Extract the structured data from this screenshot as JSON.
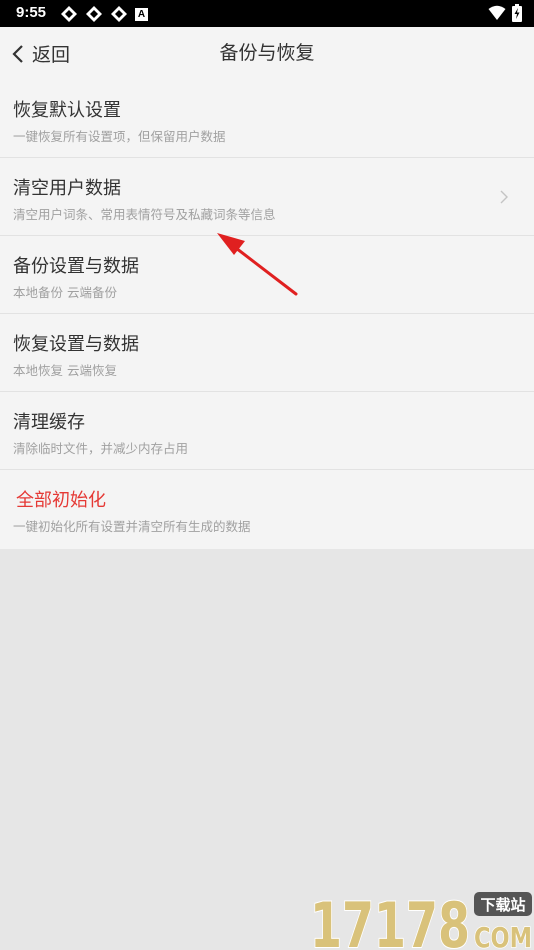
{
  "status_bar": {
    "time": "9:55",
    "indicator_badge": "A"
  },
  "nav": {
    "back_label": "返回",
    "title": "备份与恢复"
  },
  "items": [
    {
      "title": "恢复默认设置",
      "subtitle": "一键恢复所有设置项，但保留用户数据"
    },
    {
      "title": "清空用户数据",
      "subtitle": "清空用户词条、常用表情符号及私藏词条等信息"
    },
    {
      "title": "备份设置与数据",
      "subtitle": "本地备份 云端备份"
    },
    {
      "title": "恢复设置与数据",
      "subtitle": "本地恢复 云端恢复"
    },
    {
      "title": "清理缓存",
      "subtitle": "清除临时文件，并减少内存占用"
    },
    {
      "title": "全部初始化",
      "subtitle": "一键初始化所有设置并清空所有生成的数据"
    }
  ],
  "watermark": {
    "number": "17178",
    "badge": "下载站",
    "domain": "COM"
  },
  "colors": {
    "danger": "#e53935",
    "annotation": "#e02020",
    "watermark_gold": "#d9c27a"
  }
}
